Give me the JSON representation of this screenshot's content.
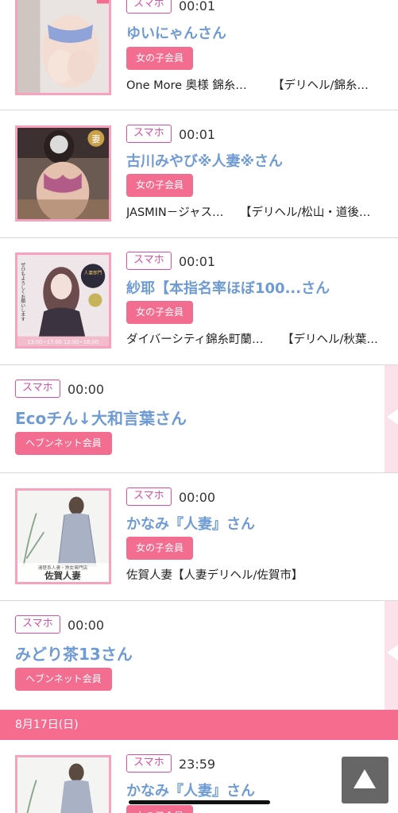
{
  "entries": [
    {
      "device": "スマホ",
      "time": "00:01",
      "name": "ゆいにゃんさん",
      "member": "女の子会員",
      "shop": "One More 奥様 錦糸…",
      "area": "【デリヘル/錦糸…"
    },
    {
      "device": "スマホ",
      "time": "00:01",
      "name": "古川みやび※人妻※さん",
      "member": "女の子会員",
      "shop": "JASMIN－ジャス…",
      "area": "【デリヘル/松山・道後…"
    },
    {
      "device": "スマホ",
      "time": "00:01",
      "name": "紗耶【本指名率ほぼ100...さん",
      "member": "女の子会員",
      "shop": "ダイバーシティ錦糸町蘭…",
      "area": "【デリヘル/秋葉…"
    },
    {
      "device": "スマホ",
      "time": "00:00",
      "name": "Ecoチん↓大和言葉さん",
      "member": "ヘブンネット会員"
    },
    {
      "device": "スマホ",
      "time": "00:00",
      "name": "かなみ『人妻』さん",
      "member": "女の子会員",
      "shop": "佐賀人妻【人妻デリヘル/佐賀市】"
    },
    {
      "device": "スマホ",
      "time": "00:00",
      "name": "みどり茶13さん",
      "member": "ヘブンネット会員"
    },
    {
      "device": "スマホ",
      "time": "23:59",
      "name": "かなみ『人妻』さん",
      "member": "女の子会員"
    }
  ],
  "thumbs": {
    "thumb2_badge": "妻",
    "thumb3_text_top": "人妻部門",
    "thumb3_text_left": "ぜひもよろしくお願いします",
    "thumb3_footer": "13:00~17:00  12:00~18:00",
    "thumb5_caption": "清楚系人妻・熟女専門店",
    "thumb5_brand": "佐賀人妻"
  },
  "date_header": "8月17日(日)",
  "colors": {
    "accent": "#f56c8f",
    "name_blue": "#6f9bd4",
    "badge_magenta": "#d94fa3"
  },
  "scroll_top_icon": "up-triangle-icon"
}
